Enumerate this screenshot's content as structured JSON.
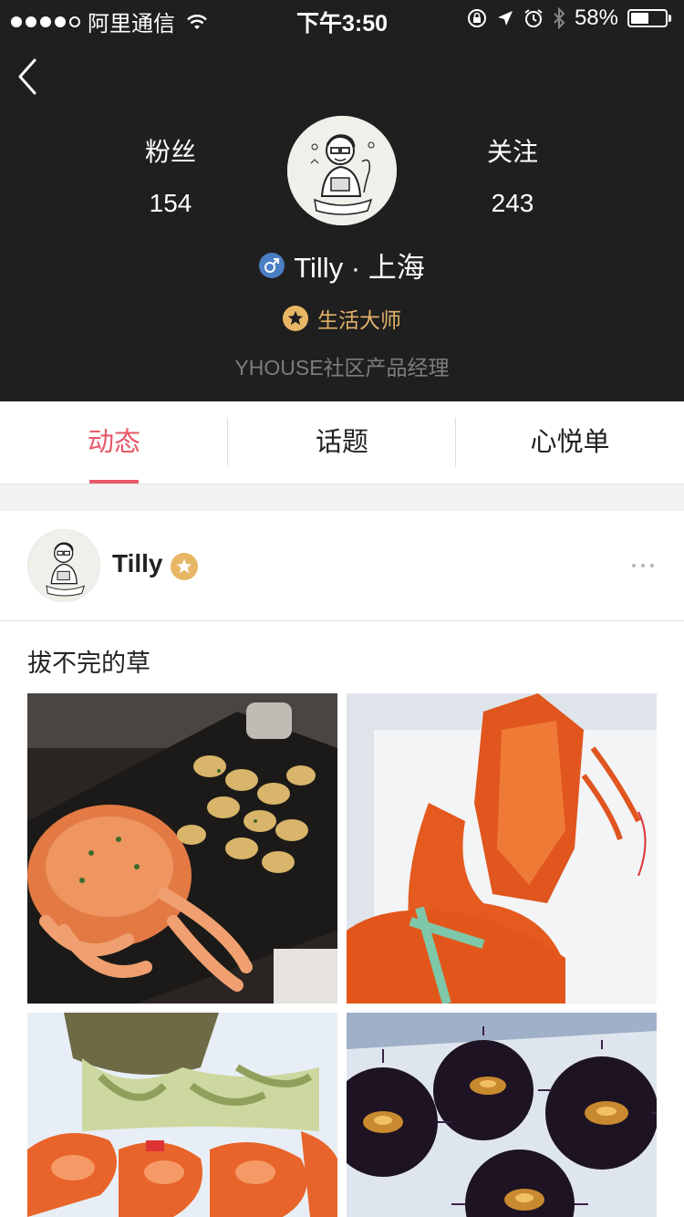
{
  "status_bar": {
    "carrier": "阿里通信",
    "time": "下午3:50",
    "battery": "58%",
    "battery_level": 0.58
  },
  "profile": {
    "fans_label": "粉丝",
    "fans_count": "154",
    "follow_label": "关注",
    "follow_count": "243",
    "name": "Tilly · 上海",
    "title_badge": "生活大师",
    "bio": "YHOUSE社区产品经理"
  },
  "tabs": [
    {
      "label": "动态",
      "active": true
    },
    {
      "label": "话题",
      "active": false
    },
    {
      "label": "心悦单",
      "active": false
    }
  ],
  "post": {
    "author": "Tilly",
    "text": "拔不完的草",
    "photos": [
      "crab-platter",
      "lobster",
      "crab-claws",
      "sea-urchins"
    ]
  },
  "colors": {
    "header_bg": "#1f1f1f",
    "accent": "#e8586a",
    "gold": "#e3b26a",
    "gender_blue": "#4b7fc4"
  }
}
